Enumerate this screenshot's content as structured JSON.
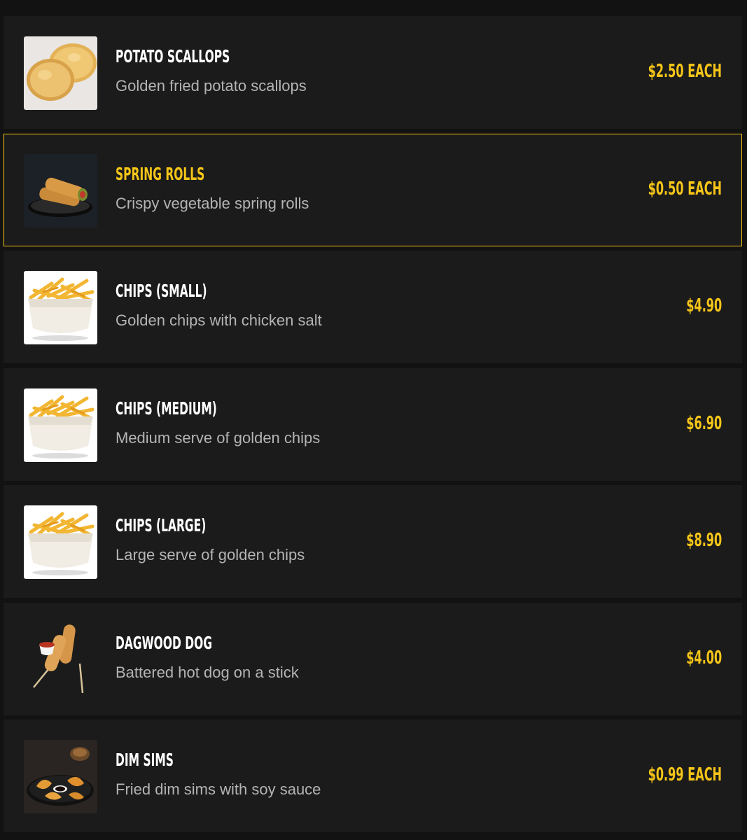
{
  "colors": {
    "background": "#121212",
    "card": "#1b1b1b",
    "accent": "#f5c518",
    "title": "#ffffff",
    "description": "#b4b4b4"
  },
  "menu": {
    "items": [
      {
        "name": "POTATO SCALLOPS",
        "description": "Golden fried potato scallops",
        "price": "$2.50 EACH",
        "image_icon": "potato-scallops-photo",
        "highlighted": false
      },
      {
        "name": "SPRING ROLLS",
        "description": "Crispy vegetable spring rolls",
        "price": "$0.50 EACH",
        "image_icon": "spring-rolls-photo",
        "highlighted": true
      },
      {
        "name": "CHIPS (SMALL)",
        "description": "Golden chips with chicken salt",
        "price": "$4.90",
        "image_icon": "chips-photo",
        "highlighted": false
      },
      {
        "name": "CHIPS (MEDIUM)",
        "description": "Medium serve of golden chips",
        "price": "$6.90",
        "image_icon": "chips-photo",
        "highlighted": false
      },
      {
        "name": "CHIPS (LARGE)",
        "description": "Large serve of golden chips",
        "price": "$8.90",
        "image_icon": "chips-photo",
        "highlighted": false
      },
      {
        "name": "DAGWOOD DOG",
        "description": "Battered hot dog on a stick",
        "price": "$4.00",
        "image_icon": "dagwood-dog-photo",
        "highlighted": false
      },
      {
        "name": "DIM SIMS",
        "description": "Fried dim sims with soy sauce",
        "price": "$0.99 EACH",
        "image_icon": "dim-sims-photo",
        "highlighted": false
      }
    ]
  }
}
